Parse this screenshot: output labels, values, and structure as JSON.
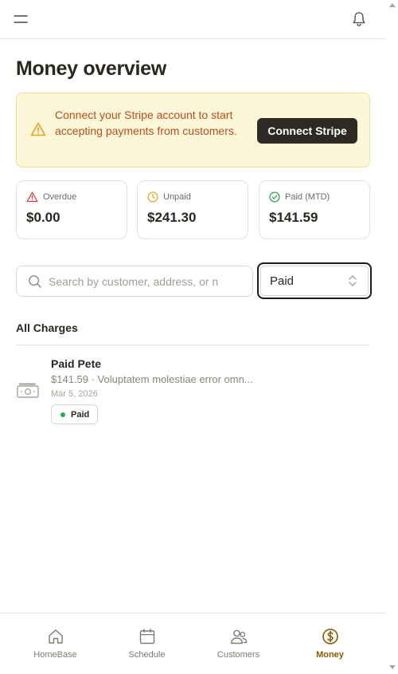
{
  "header": {
    "menu_icon": "hamburger-icon",
    "notification_icon": "bell-icon"
  },
  "page": {
    "title": "Money overview"
  },
  "banner": {
    "icon": "warning-triangle-icon",
    "message": "Connect your Stripe account to start accepting payments from customers.",
    "button_label": "Connect Stripe",
    "accent_color": "#b7501b",
    "background_color": "#fdf6d8"
  },
  "stats": [
    {
      "icon": "alert-triangle-icon",
      "label": "Overdue",
      "value": "$0.00",
      "color": "#d83a3a"
    },
    {
      "icon": "clock-icon",
      "label": "Unpaid",
      "value": "$241.30",
      "color": "#e3a21a"
    },
    {
      "icon": "check-circle-icon",
      "label": "Paid (MTD)",
      "value": "$141.59",
      "color": "#27a048"
    }
  ],
  "filters": {
    "search_placeholder": "Search by customer, address, or n",
    "search_value": "",
    "status_selected": "Paid"
  },
  "charges": {
    "section_title": "All Charges",
    "items": [
      {
        "icon": "banknote-icon",
        "customer": "Paid Pete",
        "description": "$141.59 · Voluptatem molestiae error omn...",
        "date": "Mar 5, 2026",
        "status": "Paid",
        "status_color": "#22b24c"
      }
    ]
  },
  "bottom_nav": {
    "active": "Money",
    "active_color": "#8a5a00",
    "items": [
      {
        "label": "HomeBase",
        "icon": "home-icon"
      },
      {
        "label": "Schedule",
        "icon": "calendar-icon"
      },
      {
        "label": "Customers",
        "icon": "users-icon"
      },
      {
        "label": "Money",
        "icon": "dollar-circle-icon"
      }
    ]
  }
}
